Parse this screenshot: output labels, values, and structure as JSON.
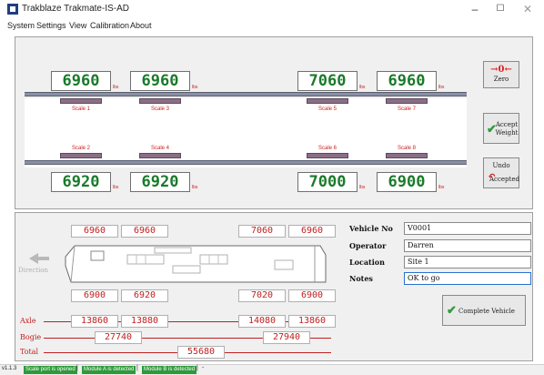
{
  "window": {
    "title": "Trakblaze Trakmate-IS-AD",
    "minimize_glyph": "–",
    "maximize_glyph": "☐",
    "close_glyph": "✕"
  },
  "menu": [
    "System",
    "Settings",
    "View",
    "Calibration",
    "About"
  ],
  "weights": {
    "unit": "lbs",
    "top": [
      "6960",
      "6960",
      "7060",
      "6960"
    ],
    "bottom": [
      "6920",
      "6920",
      "7000",
      "6900"
    ]
  },
  "scales": {
    "top": [
      "Scale 1",
      "Scale 3",
      "Scale 5",
      "Scale 7"
    ],
    "bottom": [
      "Scale 2",
      "Scale 4",
      "Scale 6",
      "Scale 8"
    ]
  },
  "buttons": {
    "zero_icon": "→0←",
    "zero": "Zero",
    "accept_line1": "Accept",
    "accept_line2": "Weight",
    "undo_line1": "Undo",
    "undo_line2": "Accepted",
    "direction": "Direction",
    "complete": "Complete Vehicle"
  },
  "vehicle": {
    "top_values": [
      "6960",
      "6960",
      "7060",
      "6960"
    ],
    "bottom_values": [
      "6900",
      "6920",
      "7020",
      "6900"
    ],
    "axle_label": "Axle",
    "axle": [
      "13860",
      "13880",
      "14080",
      "13860"
    ],
    "bogie_label": "Bogie",
    "bogie": [
      "27740",
      "27940"
    ],
    "total_label": "Total",
    "total": "55680"
  },
  "form": {
    "vehicle_no_label": "Vehicle No",
    "vehicle_no": "V0001",
    "operator_label": "Operator",
    "operator": "Darren",
    "location_label": "Location",
    "location": "Site 1",
    "notes_label": "Notes",
    "notes": "OK to go"
  },
  "status": {
    "version": "v1.1.3",
    "port": "Scale port is opened",
    "module_a": "Module A is detected",
    "module_b": "Module B is detected",
    "separator": "|",
    "trailer": "-"
  }
}
